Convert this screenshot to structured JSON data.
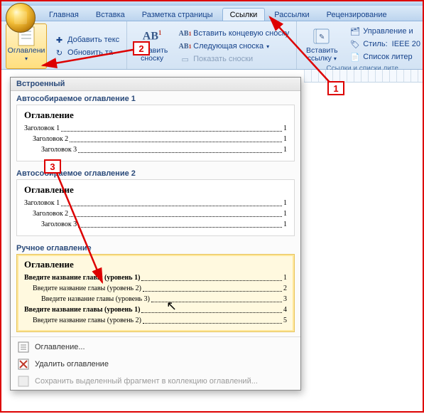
{
  "tabs": {
    "home": "Главная",
    "insert": "Вставка",
    "layout": "Разметка страницы",
    "references": "Ссылки",
    "mailings": "Рассылки",
    "review": "Рецензирование"
  },
  "ribbon": {
    "toc_btn": "Оглавлени",
    "add_text": "Добавить текс",
    "update_table": "Обновить та",
    "insert_footnote": "Вставить\nсноску",
    "ab_label": "AB",
    "insert_endnote": "Вставить концевую сноску",
    "next_footnote": "Следующая сноска",
    "show_notes": "Показать сноски",
    "insert_citation": "Вставить\nссылку",
    "manage_sources": "Управление и",
    "style_label": "Стиль:",
    "style_value": "IEEE 20",
    "bibliography": "Список литер",
    "group_caption": "Ссылки и списки лите"
  },
  "gallery": {
    "builtin": "Встроенный",
    "auto1": "Автособираемое оглавление 1",
    "auto2": "Автособираемое оглавление 2",
    "manual": "Ручное оглавление",
    "title": "Оглавление",
    "auto_rows": [
      {
        "text": "Заголовок 1",
        "page": "1",
        "indent": 0
      },
      {
        "text": "Заголовок 2",
        "page": "1",
        "indent": 1
      },
      {
        "text": "Заголовок 3",
        "page": "1",
        "indent": 2
      }
    ],
    "manual_rows": [
      {
        "text": "Введите название главы (уровень 1)",
        "page": "1",
        "indent": 0
      },
      {
        "text": "Введите название главы (уровень 2)",
        "page": "2",
        "indent": 1
      },
      {
        "text": "Введите название главы (уровень 3)",
        "page": "3",
        "indent": 2
      },
      {
        "text": "Введите название главы (уровень 1)",
        "page": "4",
        "indent": 0
      },
      {
        "text": "Введите название главы (уровень 2)",
        "page": "5",
        "indent": 1
      }
    ],
    "insert_toc": "Оглавление...",
    "remove_toc": "Удалить оглавление",
    "save_selection": "Сохранить выделенный фрагмент в коллекцию оглавлений..."
  },
  "callouts": {
    "c1": "1",
    "c2": "2",
    "c3": "3"
  }
}
